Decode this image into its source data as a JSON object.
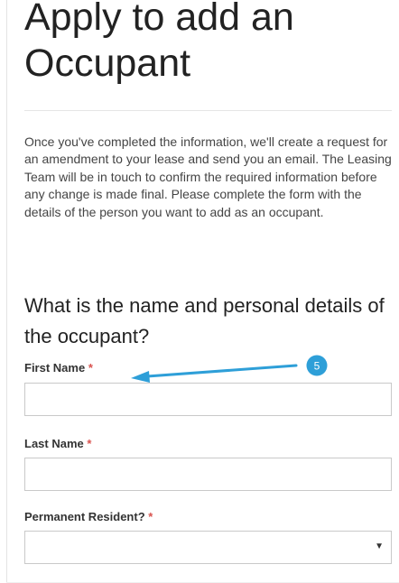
{
  "page": {
    "title_line1": "Apply to add an",
    "title_line2": "Occupant",
    "intro": "Once you've completed the information, we'll create a request for an amendment to your lease and send you an email. The Leasing Team will be in touch to confirm the required information before any change is made final. Please complete the form with the details of the person you want to add as an occupant."
  },
  "form": {
    "section_heading": "What is the name and personal details of the occupant?",
    "required_marker": "*",
    "fields": [
      {
        "label": "First Name",
        "value": "",
        "placeholder": ""
      },
      {
        "label": "Last Name",
        "value": "",
        "placeholder": ""
      },
      {
        "label": "Permanent Resident?",
        "selected": ""
      }
    ]
  },
  "annotation": {
    "step_number": "5",
    "color": "#2e9fd8",
    "icon": "arrow-left-icon"
  }
}
